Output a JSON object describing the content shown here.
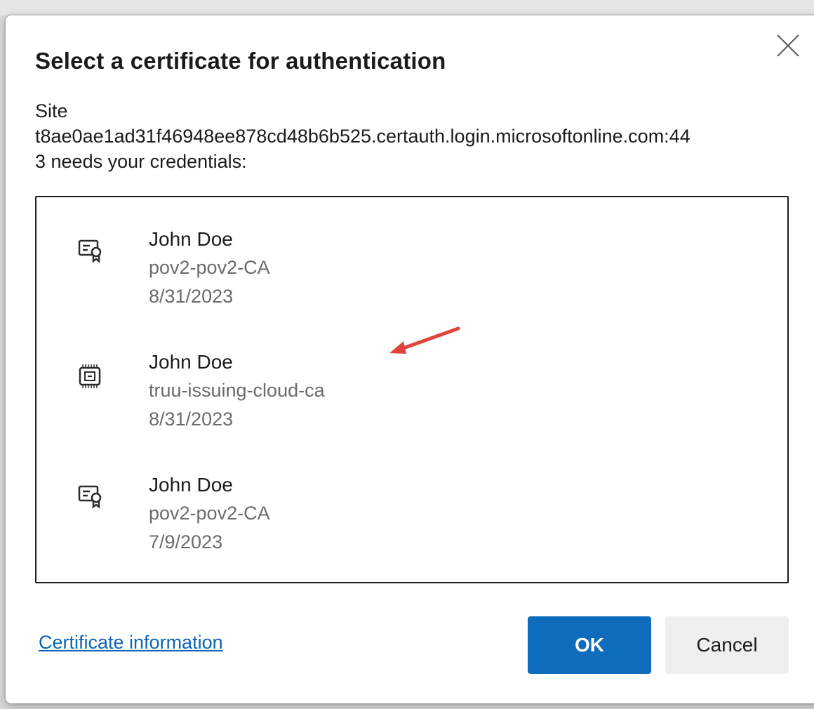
{
  "dialog": {
    "title": "Select a certificate for authentication",
    "site_label": "Site",
    "site_host_line": "t8ae0ae1ad31f46948ee878cd48b6b525.certauth.login.microsoftonline.com:44",
    "site_suffix_line": "3 needs your credentials:",
    "certificates": [
      {
        "name": "John Doe",
        "issuer": "pov2-pov2-CA",
        "date": "8/31/2023",
        "icon": "certificate-icon"
      },
      {
        "name": "John Doe",
        "issuer": "truu-issuing-cloud-ca",
        "date": "8/31/2023",
        "icon": "smartcard-chip-icon"
      },
      {
        "name": "John Doe",
        "issuer": "pov2-pov2-CA",
        "date": "7/9/2023",
        "icon": "certificate-icon"
      }
    ],
    "certificate_info_link": "Certificate information",
    "ok_label": "OK",
    "cancel_label": "Cancel"
  },
  "colors": {
    "primary_button": "#0f6cbd",
    "link": "#0d63b6",
    "annotation_arrow": "#e0453c"
  }
}
